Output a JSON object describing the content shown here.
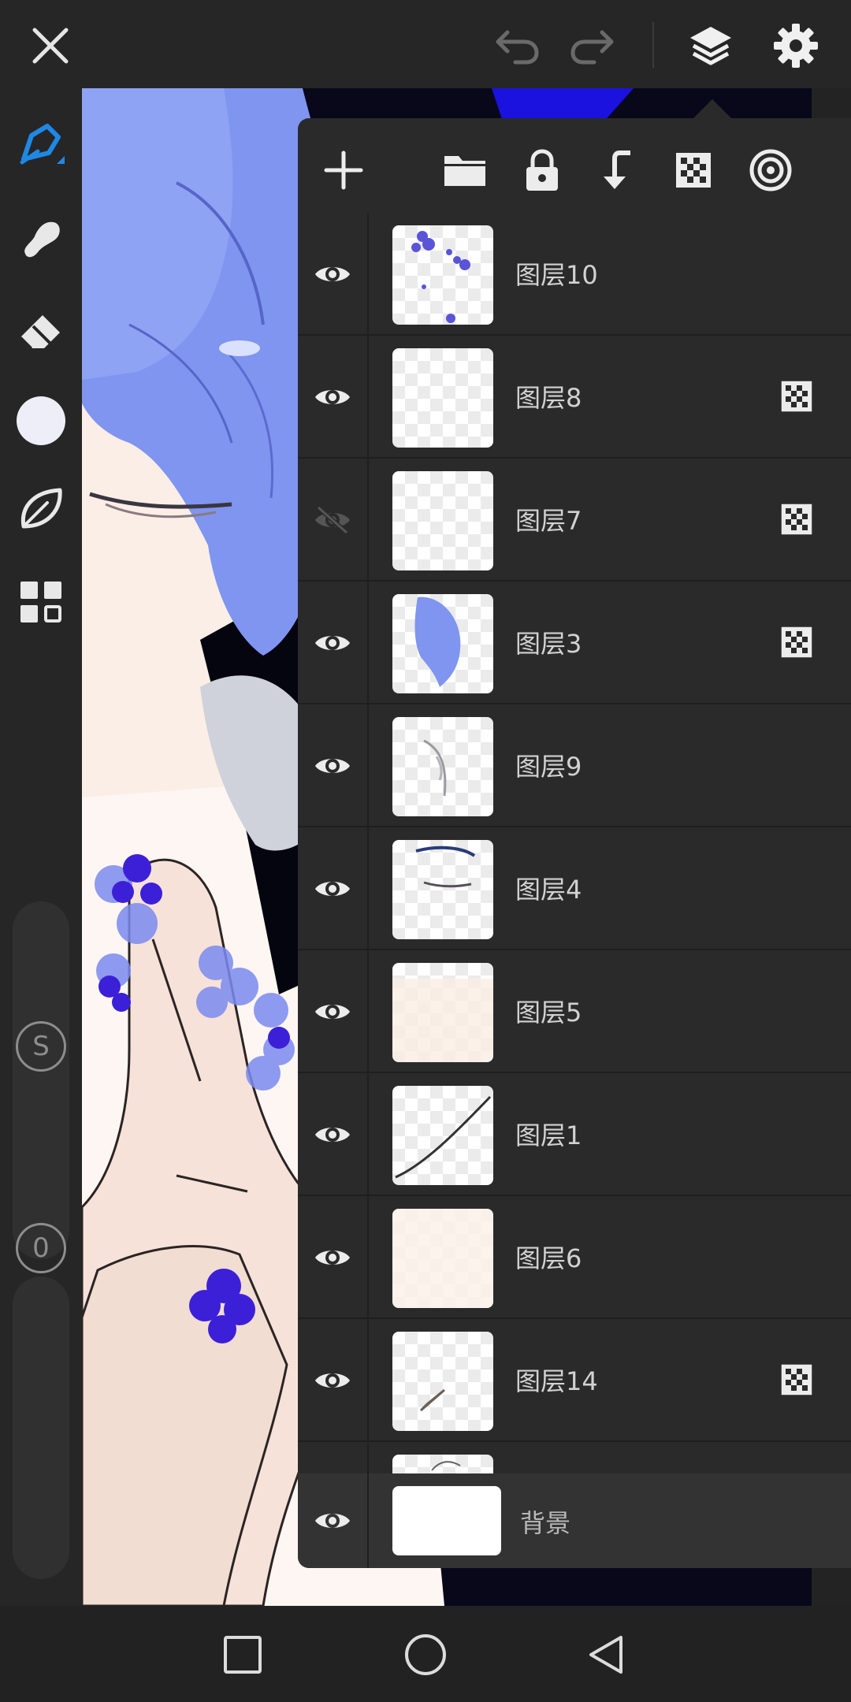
{
  "toolbar": {
    "close_icon": "close-icon",
    "undo_icon": "undo-icon",
    "redo_icon": "redo-icon",
    "layers_icon": "layers-icon",
    "settings_icon": "gear-icon"
  },
  "tools": [
    "brush-pen-icon",
    "smudge-icon",
    "eraser-icon",
    "color-swatch",
    "leaf-icon",
    "grid-icon"
  ],
  "side_sliders": {
    "size_label": "S",
    "opacity_label": "0"
  },
  "layers_panel": {
    "header_icons": [
      "add-icon",
      "folder-icon",
      "lock-icon",
      "merge-down-icon",
      "alpha-checker-icon",
      "blend-target-icon"
    ],
    "layers": [
      {
        "name": "图层10",
        "visible": true,
        "alpha_locked": false
      },
      {
        "name": "图层8",
        "visible": true,
        "alpha_locked": true
      },
      {
        "name": "图层7",
        "visible": false,
        "alpha_locked": true
      },
      {
        "name": "图层3",
        "visible": true,
        "alpha_locked": true
      },
      {
        "name": "图层9",
        "visible": true,
        "alpha_locked": false
      },
      {
        "name": "图层4",
        "visible": true,
        "alpha_locked": false
      },
      {
        "name": "图层5",
        "visible": true,
        "alpha_locked": false
      },
      {
        "name": "图层1",
        "visible": true,
        "alpha_locked": false
      },
      {
        "name": "图层6",
        "visible": true,
        "alpha_locked": false
      },
      {
        "name": "图层14",
        "visible": true,
        "alpha_locked": true
      }
    ],
    "background_layer": {
      "name": "背景",
      "visible": true
    }
  },
  "navbar": [
    "recents-square-icon",
    "home-circle-icon",
    "back-triangle-icon"
  ],
  "colors": {
    "accent": "#1e88e5",
    "panel": "#2a2a2a",
    "hair": "#7c93ee",
    "flower": "#4a3ad8"
  }
}
